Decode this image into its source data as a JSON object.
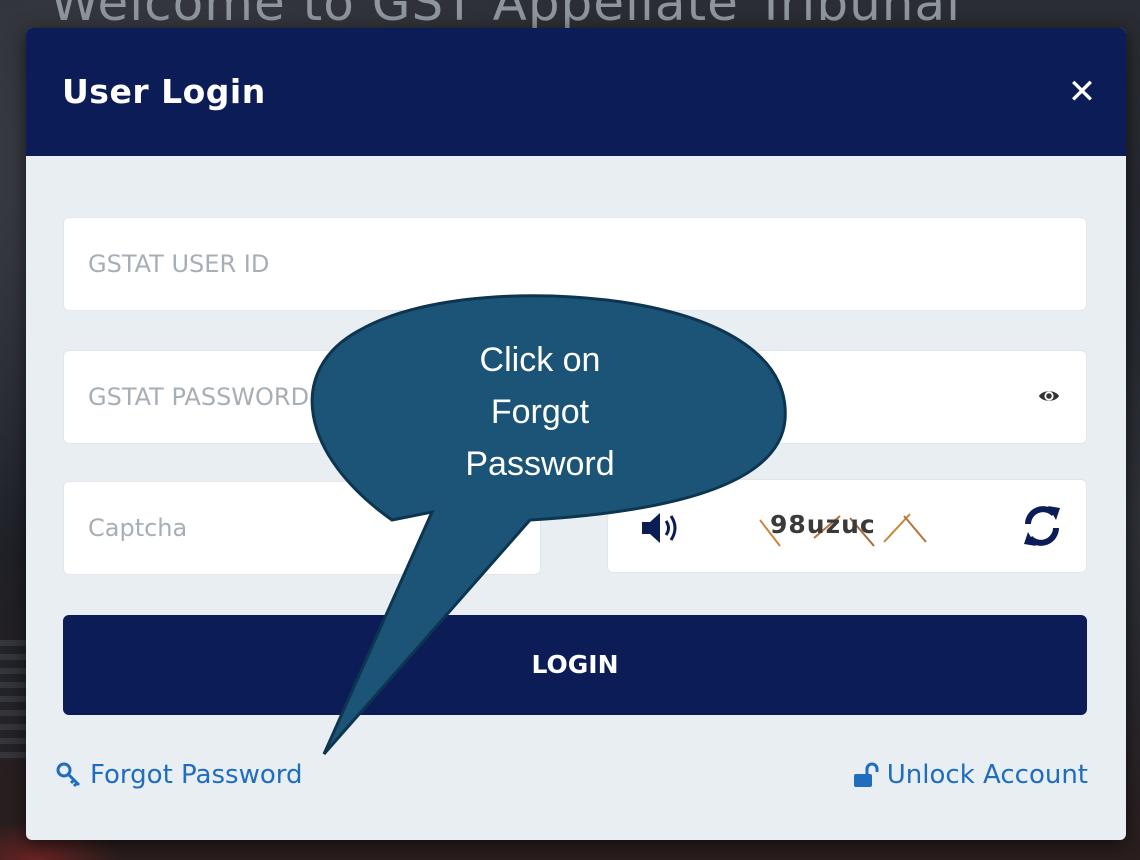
{
  "background": {
    "title": "Welcome to GST Appellate Tribunal"
  },
  "modal": {
    "title": "User Login",
    "close_icon": "close-icon"
  },
  "form": {
    "user_id_placeholder": "GSTAT USER ID",
    "password_placeholder": "GSTAT PASSWORD",
    "captcha_placeholder": "Captcha",
    "captcha_text": "98uzuc",
    "login_label": "LOGIN"
  },
  "links": {
    "forgot_password": "Forgot Password",
    "unlock_account": "Unlock Account"
  },
  "callout": {
    "line1": "Click on",
    "line2": "Forgot",
    "line3": "Password"
  },
  "colors": {
    "header": "#0c1c57",
    "modal_body": "#e8eef2",
    "link": "#1f6dbd",
    "callout_fill": "#1b5476",
    "callout_stroke": "#0d3550"
  }
}
